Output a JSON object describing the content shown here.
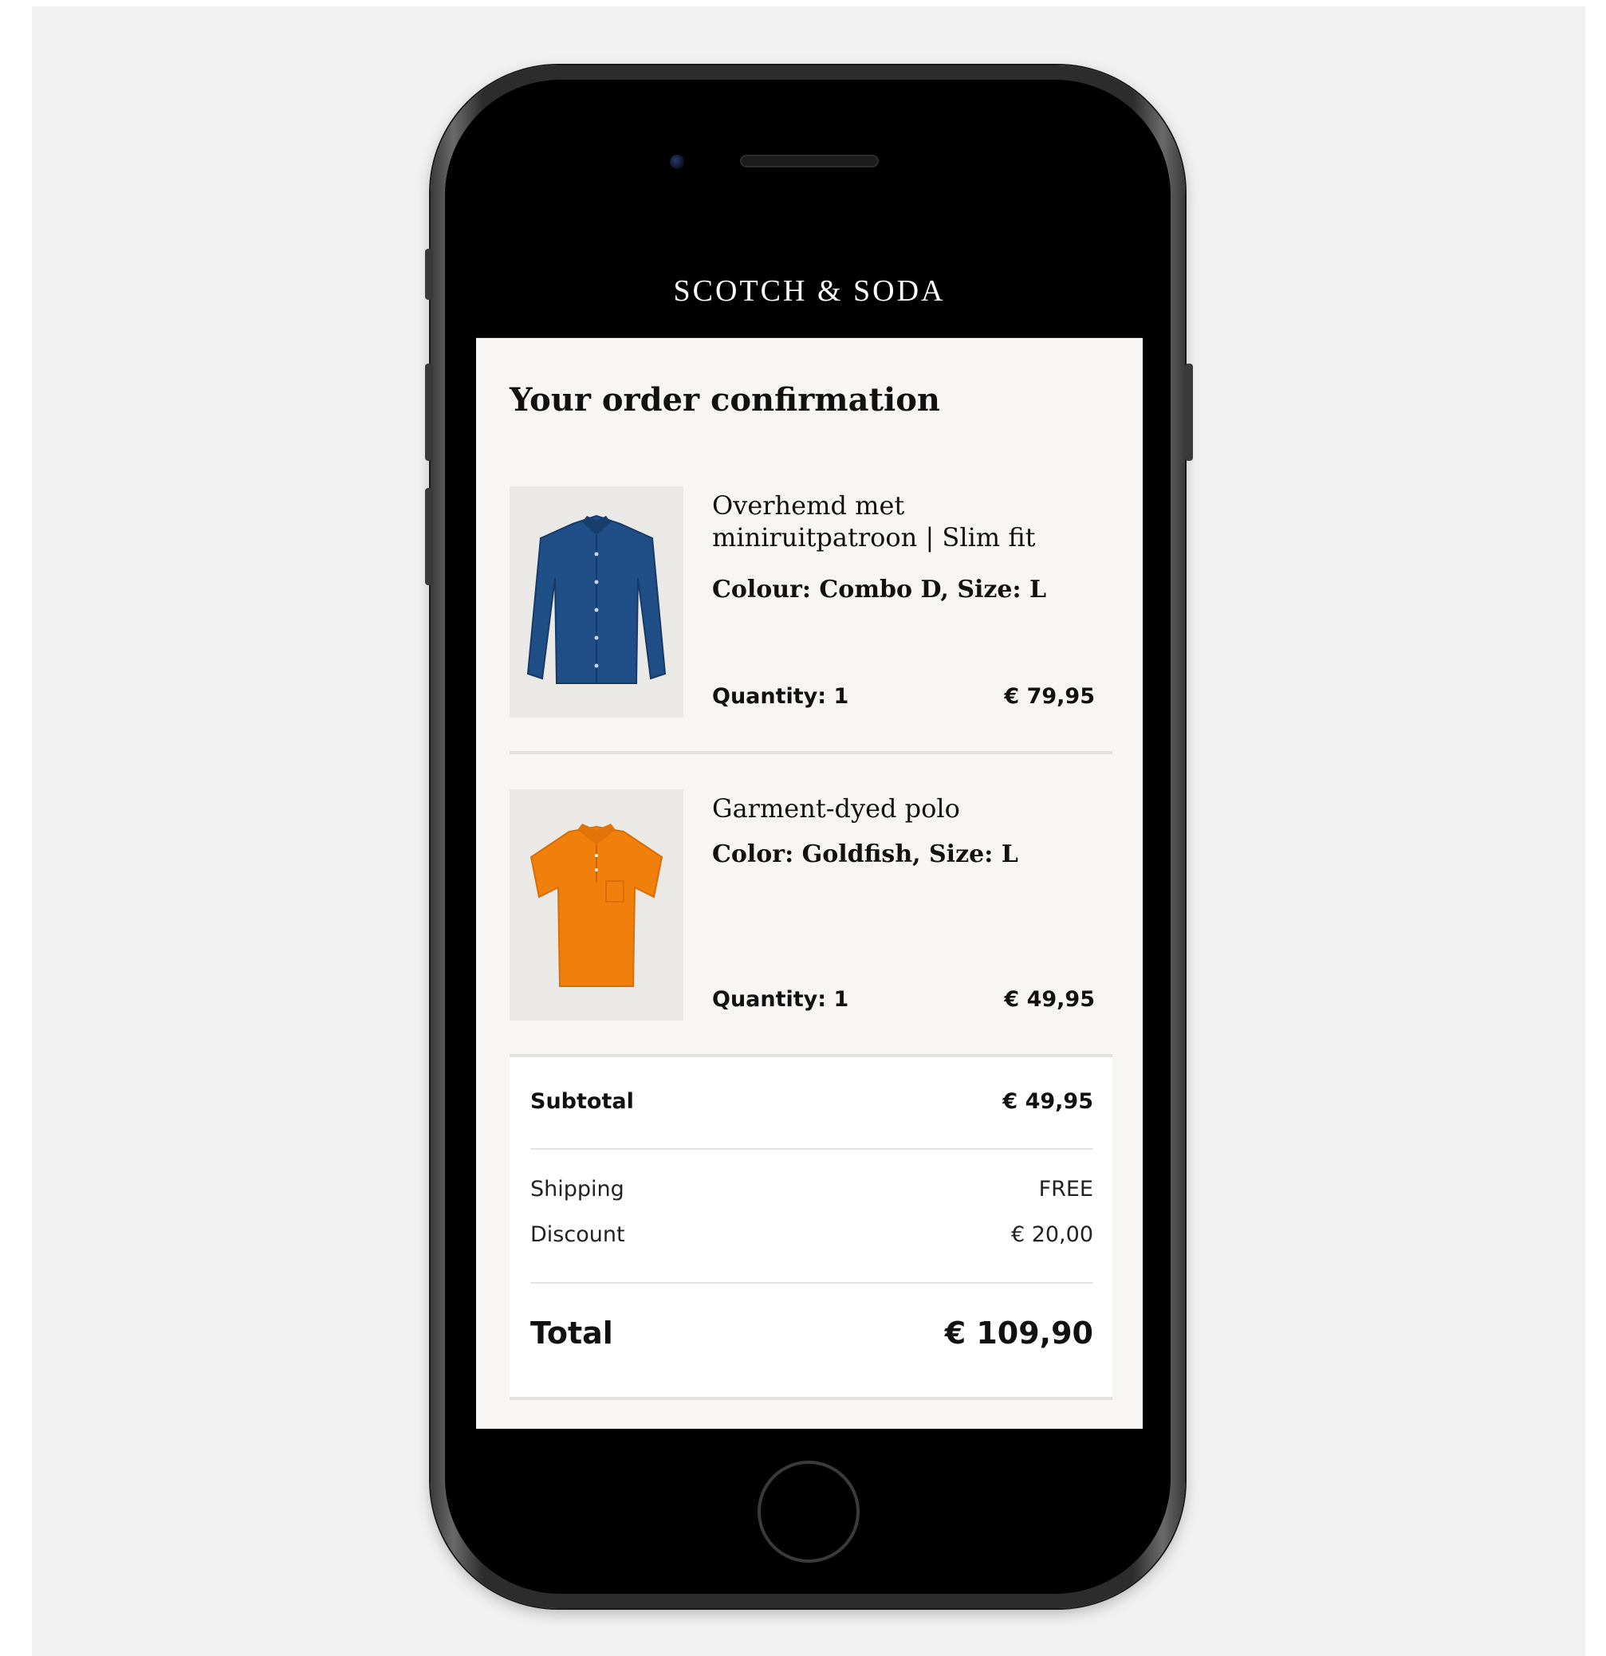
{
  "brand": {
    "logo_text": "SCOTCH & SODA"
  },
  "page": {
    "title": "Your order confirmation"
  },
  "items": [
    {
      "name": "Overhemd met miniruitpatroon | Slim fit",
      "variant": "Colour: Combo D, Size: L",
      "quantity": "Quantity: 1",
      "price": "€ 79,95",
      "image_color": "#1f4f86"
    },
    {
      "name": "Garment-dyed polo",
      "variant": "Color: Goldfish, Size: L",
      "quantity": "Quantity: 1",
      "price": "€ 49,95",
      "image_color": "#f07f0c"
    }
  ],
  "summary": {
    "subtotal_label": "Subtotal",
    "subtotal_value": "€ 49,95",
    "shipping_label": "Shipping",
    "shipping_value": "FREE",
    "discount_label": "Discount",
    "discount_value": "€ 20,00",
    "total_label": "Total",
    "total_value": "€ 109,90"
  },
  "colors": {
    "header_bg": "#000000",
    "screen_bg": "#f7f6f4",
    "backdrop": "#f1f1f1"
  }
}
